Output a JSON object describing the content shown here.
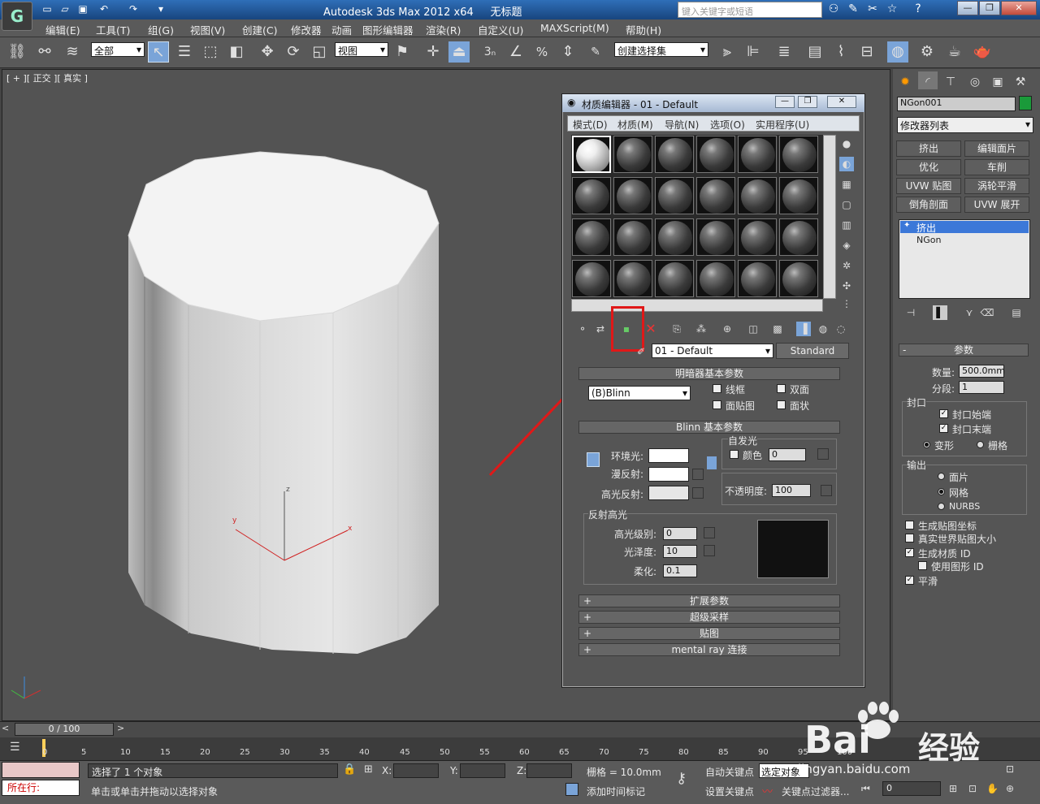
{
  "titlebar": {
    "app_title": "Autodesk 3ds Max  2012 x64",
    "doc_name": "无标题",
    "search_placeholder": "键入关键字或短语"
  },
  "menubar": {
    "items": [
      "编辑(E)",
      "工具(T)",
      "组(G)",
      "视图(V)",
      "创建(C)",
      "修改器",
      "动画",
      "图形编辑器",
      "渲染(R)",
      "自定义(U)",
      "MAXScript(M)",
      "帮助(H)"
    ]
  },
  "toolbar": {
    "selection_filter": "全部",
    "ref_coord": "视图",
    "named_sel_set": "创建选择集",
    "snap_label": "3"
  },
  "viewport": {
    "label": "[ + ][ 正交 ][ 真实 ]",
    "axis_x": "x",
    "axis_y": "y",
    "axis_z": "z"
  },
  "material_editor": {
    "title": "材质编辑器 - 01 - Default",
    "menu": [
      "模式(D)",
      "材质(M)",
      "导航(N)",
      "选项(O)",
      "实用程序(U)"
    ],
    "material_name": "01 - Default",
    "material_type": "Standard",
    "shader_rollout": "明暗器基本参数",
    "shader_value": "(B)Blinn",
    "shader_checks": [
      "线框",
      "双面",
      "面贴图",
      "面状"
    ],
    "blinn_rollout": "Blinn 基本参数",
    "self_illum_group": "自发光",
    "self_illum_color_label": "颜色",
    "self_illum_value": "0",
    "ambient_label": "环境光:",
    "diffuse_label": "漫反射:",
    "specular_label": "高光反射:",
    "opacity_label": "不透明度:",
    "opacity_value": "100",
    "spec_group": "反射高光",
    "spec_level_label": "高光级别:",
    "spec_level_value": "0",
    "gloss_label": "光泽度:",
    "gloss_value": "10",
    "soften_label": "柔化:",
    "soften_value": "0.1",
    "rollouts": [
      "扩展参数",
      "超级采样",
      "贴图",
      "mental ray 连接"
    ]
  },
  "command_panel": {
    "object_name": "NGon001",
    "modifier_list": "修改器列表",
    "mod_buttons": [
      "挤出",
      "编辑面片",
      "优化",
      "车削",
      "UVW 贴图",
      "涡轮平滑",
      "倒角剖面",
      "UVW 展开"
    ],
    "stack": [
      "挤出",
      "NGon"
    ],
    "params_title": "参数",
    "amount_label": "数量:",
    "amount_value": "500.0mm",
    "segments_label": "分段:",
    "segments_value": "1",
    "capping_group": "封口",
    "cap_start": "封口始端",
    "cap_end": "封口末端",
    "morph": "变形",
    "grid": "栅格",
    "output_group": "输出",
    "out_patch": "面片",
    "out_mesh": "网格",
    "out_nurbs": "NURBS",
    "gen_map_coords": "生成贴图坐标",
    "real_world": "真实世界贴图大小",
    "gen_mat_ids": "生成材质 ID",
    "use_shape_ids": "使用图形 ID",
    "smooth": "平滑"
  },
  "timeline": {
    "frame": "0 / 100",
    "ticks": [
      "0",
      "5",
      "10",
      "15",
      "20",
      "25",
      "30",
      "35",
      "40",
      "45",
      "50",
      "55",
      "60",
      "65",
      "70",
      "75",
      "80",
      "85",
      "90",
      "95",
      "100"
    ]
  },
  "status": {
    "maxscript": "所在行:",
    "selected": "选择了 1 个对象",
    "prompt": "单击或单击并拖动以选择对象",
    "x_label": "X:",
    "y_label": "Y:",
    "z_label": "Z:",
    "grid": "栅格 = 10.0mm",
    "add_time_tag": "添加时间标记",
    "auto_key": "自动关键点",
    "selected_obj": "选定对象",
    "set_key": "设置关键点",
    "key_filters": "关键点过滤器...",
    "frame_value": "0"
  },
  "watermark": {
    "brand": "Bai",
    "brand_cn": "经验",
    "url": "jingyan.baidu.com"
  },
  "colors": {
    "annotation_red": "#e01818",
    "title_blue": "#2f6fb8"
  }
}
